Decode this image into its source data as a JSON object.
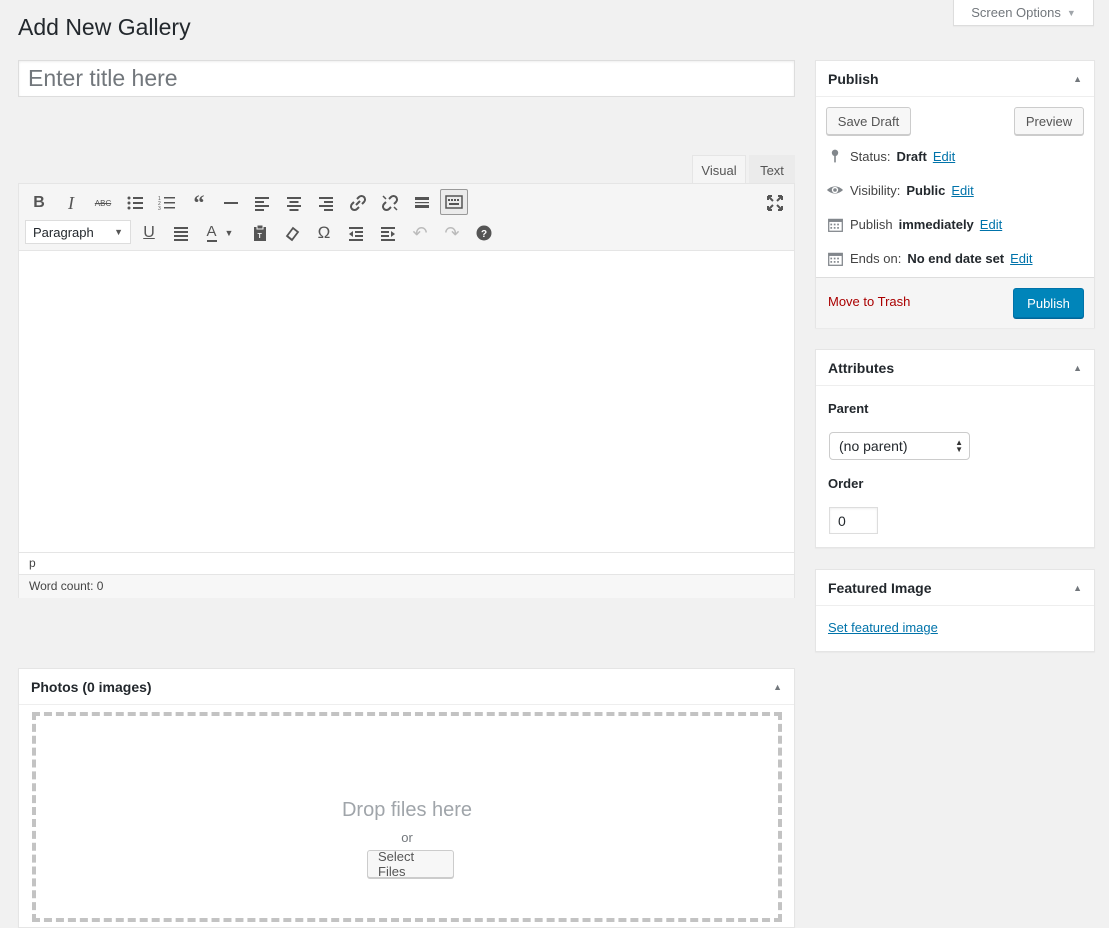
{
  "page": {
    "title": "Add New Gallery",
    "screen_options": "Screen Options"
  },
  "title_field": {
    "placeholder": "Enter title here",
    "value": ""
  },
  "editor": {
    "tabs": [
      "Visual",
      "Text"
    ],
    "active_tab": "Visual",
    "toolbar_row1": [
      "bold-icon",
      "italic-icon",
      "strikethrough-icon",
      "bullet-list-icon",
      "numbered-list-icon",
      "blockquote-icon",
      "horizontal-line-icon",
      "align-left-icon",
      "align-center-icon",
      "align-right-icon",
      "link-icon",
      "unlink-icon",
      "read-more-icon",
      "toolbar-toggle-icon",
      "fullscreen-icon"
    ],
    "toolbar_row2": [
      "underline-icon",
      "justify-icon",
      "text-color-icon",
      "paste-text-icon",
      "clear-formatting-icon",
      "special-character-icon",
      "outdent-icon",
      "indent-icon",
      "undo-icon",
      "redo-icon",
      "help-icon"
    ],
    "format_select": "Paragraph",
    "path": "p",
    "word_count": "Word count: 0"
  },
  "publish": {
    "title": "Publish",
    "save_draft": "Save Draft",
    "preview": "Preview",
    "status_label": "Status:",
    "status_value": "Draft",
    "visibility_label": "Visibility:",
    "visibility_value": "Public",
    "publish_label": "Publish",
    "publish_value": "immediately",
    "ends_label": "Ends on:",
    "ends_value": "No end date set",
    "edit_link": "Edit",
    "move_to_trash": "Move to Trash",
    "publish_button": "Publish",
    "accent_color": "#0085ba",
    "trash_color": "#aa0000"
  },
  "attributes": {
    "title": "Attributes",
    "parent_label": "Parent",
    "parent_value": "(no parent)",
    "order_label": "Order",
    "order_value": "0"
  },
  "featured_image": {
    "title": "Featured Image",
    "link": "Set featured image"
  },
  "photos": {
    "title": "Photos (0 images)",
    "drop_text": "Drop files here",
    "or_text": "or",
    "select_files": "Select Files"
  }
}
